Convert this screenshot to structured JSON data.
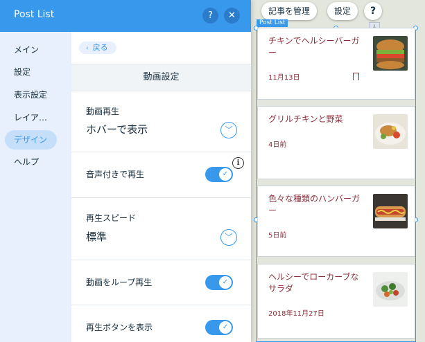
{
  "panel": {
    "title": "Post List",
    "help_label": "?",
    "close_label": "✕"
  },
  "nav": {
    "items": [
      {
        "label": "メイン"
      },
      {
        "label": "設定"
      },
      {
        "label": "表示設定"
      },
      {
        "label": "レイア…"
      },
      {
        "label": "デザイン",
        "active": true
      },
      {
        "label": "ヘルプ"
      }
    ]
  },
  "content": {
    "back_label": "戻る",
    "section_title": "動画設定",
    "video_playback": {
      "label": "動画再生",
      "value": "ホバーで表示"
    },
    "play_with_sound": {
      "label": "音声付きで再生",
      "on": true
    },
    "playback_speed": {
      "label": "再生スピード",
      "value": "標準"
    },
    "loop_video": {
      "label": "動画をループ再生",
      "on": true
    },
    "show_play_button": {
      "label": "再生ボタンを表示",
      "on": true
    }
  },
  "editor": {
    "manage_posts_label": "記事を管理",
    "settings_label": "設定",
    "help_label": "?",
    "frame_label": "Post List",
    "posts": [
      {
        "title": "チキンでヘルシーバーガー",
        "date": "11月13日",
        "thumb": "burger-photo",
        "bookmark": true
      },
      {
        "title": "グリルチキンと野菜",
        "date": "4日前",
        "thumb": "chicken-photo"
      },
      {
        "title": "色々な種類のハンバーガー",
        "date": "5日前",
        "thumb": "hotdog-photo"
      },
      {
        "title": "ヘルシーでローカーブなサラダ",
        "date": "2018年11月27日",
        "thumb": "salad-photo"
      }
    ]
  },
  "colors": {
    "accent": "#3899ec",
    "header": "#3899ec",
    "post_text": "#8a2d3a",
    "editor_bg": "#e2e6dc"
  }
}
